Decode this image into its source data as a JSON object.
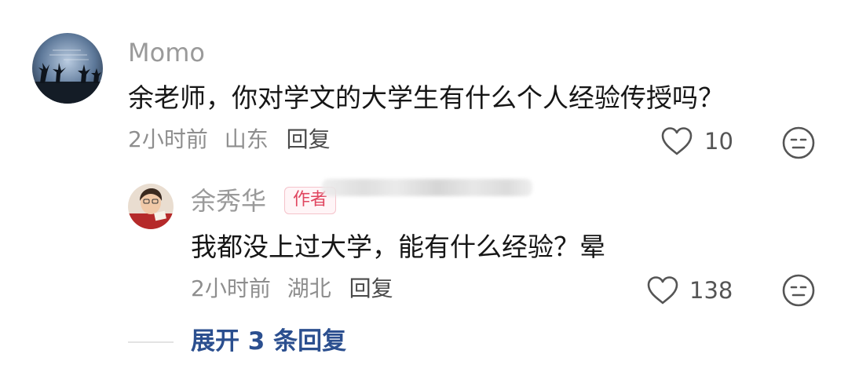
{
  "comment": {
    "username": "Momo",
    "text": "余老师，你对学文的大学生有什么个人经验传授吗？",
    "time": "2小时前",
    "location": "山东",
    "reply_label": "回复",
    "likes": "10",
    "like_icon": "heart-outline-icon",
    "dislike_icon": "meh-face-icon"
  },
  "reply": {
    "username": "余秀华",
    "badge": "作者",
    "text": "我都没上过大学，能有什么经验？晕",
    "time": "2小时前",
    "location": "湖北",
    "reply_label": "回复",
    "likes": "138",
    "like_icon": "heart-outline-icon",
    "dislike_icon": "meh-face-icon"
  },
  "expand": {
    "label": "展开 3 条回复"
  },
  "colors": {
    "username": "#9a9a9a",
    "text": "#161616",
    "meta": "#8e8e8e",
    "badge": "#e0455f",
    "expand": "#2b4f8f"
  }
}
